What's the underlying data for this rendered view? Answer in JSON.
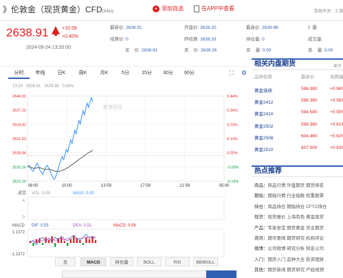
{
  "title": {
    "main": "》伦敦金（现货黄金）CFD",
    "code": "(XAU)"
  },
  "actions": {
    "add": "添加自选",
    "app": "在APP中查看"
  },
  "data_source": "数据来源：汇通",
  "quote": {
    "price": "2638.91",
    "change": "+10.58",
    "change_pct": "+0.40%",
    "time": "2024-09-24 13:20:00"
  },
  "fields": {
    "latest_label": "最新价:",
    "latest": "2638.91",
    "open_label": "开盘价:",
    "open": "2628.20",
    "high_label": "最高价:",
    "high": "2639.96",
    "right1_label": "》最",
    "settle_label": "结算价:",
    "settle": "0",
    "prev_label": "昨结算:",
    "prev": "2628.33",
    "hold_label": "持仓量:",
    "hold": "0",
    "vol_label": "成交量:",
    "vol": "",
    "buy_label": "买",
    "buy_suffix": "价:",
    "buy": "2638.91",
    "sell_label": "卖",
    "sell_suffix": "价:",
    "sell": "2639.26",
    "bq_label": "买",
    "bq_suffix": "量:",
    "bq": "0.00",
    "sq_label": "卖",
    "sq_suffix": "量:",
    "sq": "0.00"
  },
  "tabs": [
    "分时",
    "年线",
    "日K",
    "周K",
    "月K",
    "5分",
    "15分",
    "30分",
    "60分"
  ],
  "chart_info": {
    "time": "13:20",
    "price": "2638.91",
    "avg": "2629.36",
    "pct": "0.40%",
    "watermark": "新浪财经"
  },
  "chart_data": {
    "type": "line",
    "x_ticks": [
      "06:00",
      "10:00",
      "13:59",
      "17:59",
      "21:59",
      "05:00"
    ],
    "y_ticks_left": [
      "2640.01",
      "2637.22",
      "2634.42",
      "2631.63",
      "2628.84",
      "2626.04",
      "2623.25"
    ],
    "y_ticks_right": [
      "0.44%",
      "0.34%",
      "0.23%",
      "0.13%",
      "0.02%",
      "-0.09%",
      "-0.19%"
    ],
    "ylim": [
      2623.25,
      2640.01
    ],
    "price": [
      2626.1,
      2626.4,
      2625.9,
      2625.5,
      2625.2,
      2625.7,
      2626.3,
      2626.8,
      2626.2,
      2625.4,
      2625.0,
      2624.6,
      2625.3,
      2626.0,
      2626.4,
      2626.0,
      2625.4,
      2624.7,
      2624.1,
      2623.6,
      2623.9,
      2624.7,
      2625.6,
      2626.6,
      2627.3,
      2628.1,
      2627.5,
      2628.4,
      2629.5,
      2629.0,
      2630.3,
      2631.4,
      2630.7,
      2631.9,
      2633.3,
      2632.6,
      2634.0,
      2635.2,
      2634.5,
      2635.9,
      2637.1,
      2636.3,
      2637.6,
      2638.6,
      2637.8,
      2638.9,
      2639.7,
      2638.91
    ],
    "avg": [
      2626.1,
      2626.1,
      2626.0,
      2625.9,
      2625.8,
      2625.8,
      2625.8,
      2625.9,
      2625.9,
      2625.9,
      2625.8,
      2625.7,
      2625.6,
      2625.6,
      2625.6,
      2625.6,
      2625.6,
      2625.5,
      2625.4,
      2625.3,
      2625.2,
      2625.2,
      2625.2,
      2625.2,
      2625.3,
      2625.4,
      2625.5,
      2625.6,
      2625.8,
      2625.9,
      2626.1,
      2626.3,
      2626.5,
      2626.7,
      2626.9,
      2627.1,
      2627.3,
      2627.5,
      2627.7,
      2627.9,
      2628.1,
      2628.3,
      2628.5,
      2628.7,
      2628.9,
      2629.0,
      2629.2,
      2629.36
    ],
    "prev_close": 2628.33
  },
  "volume": {
    "label": "成交",
    "vol_label": "VOL: 0.00",
    "ma_label": "MA10: 0.00",
    "y_top": "4",
    "y_bot": "0"
  },
  "macd": {
    "label": "MACD",
    "dif": "DIF: 0.55",
    "dea": "DEA: 0.51",
    "macd": "MACD: 0.08",
    "y_top": "1.1372",
    "y_bot": "-1.1372",
    "hist": [
      0.2,
      -0.3,
      0.4,
      0.5,
      -0.2,
      0.6,
      0.3,
      0.7,
      -0.4,
      0.5,
      0.6,
      0.2,
      -0.3,
      0.4,
      0.8,
      0.5,
      0.3,
      -0.2,
      0.6,
      0.4,
      0.7,
      0.3
    ],
    "dif_line": [
      0.1,
      0.3,
      -0.2,
      0.4,
      0.6,
      0.2,
      0.5,
      0.1,
      0.6,
      0.3,
      0.7,
      0.4,
      0.2,
      0.6,
      0.8,
      0.5,
      0.3,
      0.6,
      0.9,
      0.5,
      0.7,
      0.55
    ],
    "dea_line": [
      0.2,
      0.1,
      0.2,
      0.3,
      0.2,
      0.4,
      0.3,
      0.5,
      0.2,
      0.4,
      0.5,
      0.3,
      0.5,
      0.4,
      0.6,
      0.4,
      0.5,
      0.5,
      0.6,
      0.6,
      0.5,
      0.51
    ]
  },
  "indicators": [
    "无",
    "MACD",
    "持仓量",
    "BOLL",
    "RSI",
    "BBIBOLL"
  ],
  "related": {
    "title": "相关内盘期货",
    "more": "更多",
    "headers": [
      "品种名称",
      "最新价",
      "涨跌幅"
    ],
    "rows": [
      [
        "黄金连续",
        "596.380",
        "+0.56%"
      ],
      [
        "黄金2412",
        "596.380",
        "+0.56%"
      ],
      [
        "黄金2410",
        "594.580",
        "+0.55%"
      ],
      [
        "黄金2502",
        "598.380",
        "+0.61%"
      ],
      [
        "黄金2508",
        "604.460",
        "+0.62%"
      ],
      [
        "黄金2510",
        "607.000",
        "+0.63%"
      ]
    ]
  },
  "hot": {
    "title": "热点推荐",
    "rows": [
      {
        "k": "商品：",
        "v": "商品行情 外盘期货 期货排名"
      },
      {
        "k": "期指：",
        "v": "期指行情 行业指数 权重股票"
      },
      {
        "k": "持仓：",
        "v": "商品持仓 期指持仓 CFTC持仓"
      },
      {
        "k": "现货：",
        "v": "现货报价 上海有色 黄金现货"
      },
      {
        "k": "产品：",
        "v": "专家坐堂 期货黄金 农业期货"
      },
      {
        "k": "资讯：",
        "v": "期市要闻 期货研究 机构评论"
      },
      {
        "k": "微博：",
        "v": "公司微博 研究分析 知名公司"
      },
      {
        "k": "入门：",
        "v": "期货入门 品种大全 投资理财"
      },
      {
        "k": "其他：",
        "v": "期货新闻 期货研究 产经视频"
      }
    ]
  }
}
